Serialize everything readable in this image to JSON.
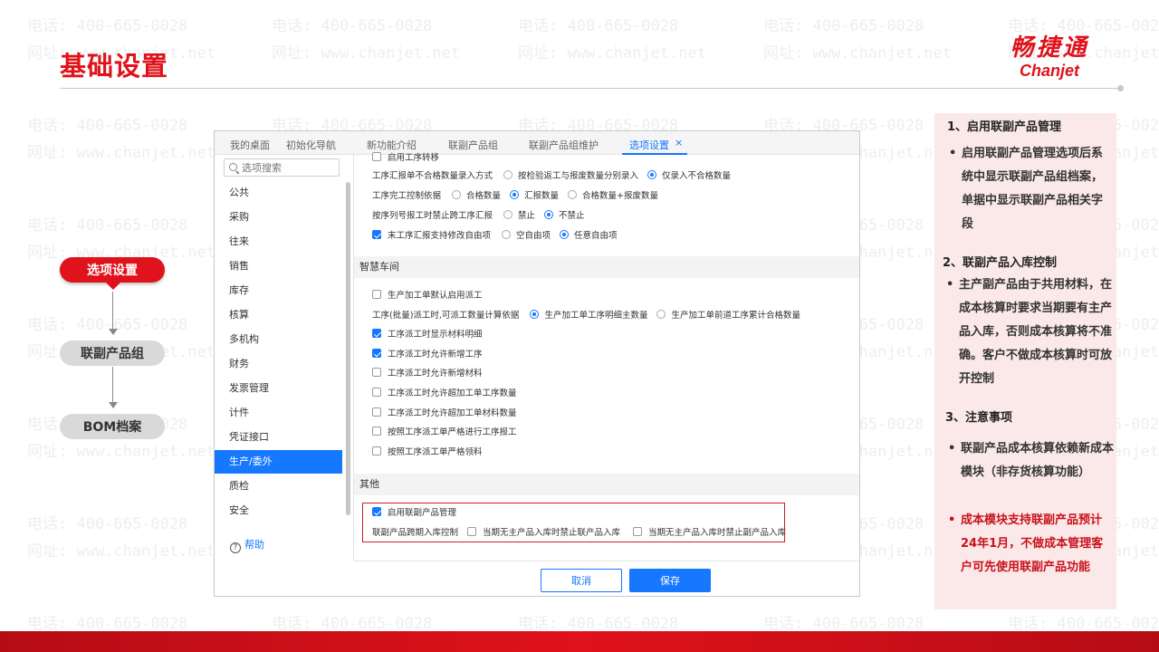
{
  "watermark": {
    "phone": "电话: 400-665-0028",
    "site": "网址: www.chanjet.net"
  },
  "header": {
    "title": "基础设置",
    "brand_cn": "畅捷通",
    "brand_en": "Chanjet"
  },
  "flow": {
    "step1": "选项设置",
    "step2": "联副产品组",
    "step3": "BOM档案"
  },
  "app": {
    "tabs": [
      "我的桌面",
      "初始化导航",
      "新功能介绍",
      "联副产品组",
      "联副产品组维护",
      "选项设置"
    ],
    "tab_close": "×",
    "search_placeholder": "选项搜索",
    "nav": [
      "公共",
      "采购",
      "往来",
      "销售",
      "库存",
      "核算",
      "多机构",
      "财务",
      "发票管理",
      "计件",
      "凭证接口",
      "生产/委外",
      "质检",
      "安全"
    ],
    "help": "帮助",
    "help_icon": "?",
    "top_rows": {
      "partial": "启用工序转移",
      "r1_label": "工序汇报单不合格数量录入方式",
      "r1_opt1": "按检验返工与报废数量分别录入",
      "r1_opt2": "仅录入不合格数量",
      "r2_label": "工序完工控制依据",
      "r2_opt1": "合格数量",
      "r2_opt2": "汇报数量",
      "r2_opt3": "合格数量+报废数量",
      "r3_label": "按序列号报工时禁止跨工序汇报",
      "r3_opt1": "禁止",
      "r3_opt2": "不禁止",
      "r4_label": "末工序汇报支持修改自由项",
      "r4_opt1": "空自由项",
      "r4_opt2": "任意自由项"
    },
    "section_workshop": "智慧车间",
    "workshop": {
      "w1": "生产加工单默认启用派工",
      "w2_label": "工序(批量)派工时,可派工数量计算依据",
      "w2_opt1": "生产加工单工序明细主数量",
      "w2_opt2": "生产加工单前道工序累计合格数量",
      "w3": "工序派工时显示材料明细",
      "w4": "工序派工时允许新增工序",
      "w5": "工序派工时允许新增材料",
      "w6": "工序派工时允许超加工单工序数量",
      "w7": "工序派工时允许超加工单材料数量",
      "w8": "按照工序派工单严格进行工序报工",
      "w9": "按照工序派工单严格领料"
    },
    "section_other": "其他",
    "other": {
      "o1": "启用联副产品管理",
      "o2_label": "联副产品跨期入库控制",
      "o2_opt1": "当期无主产品入库时禁止联产品入库",
      "o2_opt2": "当期无主产品入库时禁止副产品入库"
    },
    "buttons": {
      "cancel": "取消",
      "save": "保存"
    }
  },
  "notes": {
    "h1": "1、启用联副产品管理",
    "p1": "启用联副产品管理选项后系统中显示联副产品组档案，单据中显示联副产品相关字段",
    "h2": "2、联副产品入库控制",
    "p2": "主产副产品由于共用材料，在成本核算时要求当期要有主产品入库，否则成本核算将不准确。客户不做成本核算时可放开控制",
    "h3": "3、注意事项",
    "p3": "联副产品成本核算依赖新成本模块（非存货核算功能）",
    "p4": "成本模块支持联副产品预计24年1月，不做成本管理客户可先使用联副产品功能",
    "bullet": "•"
  },
  "colors": {
    "accent_red": "#e0121b",
    "app_blue": "#1677ff",
    "note_bg": "#fbe9e9"
  }
}
